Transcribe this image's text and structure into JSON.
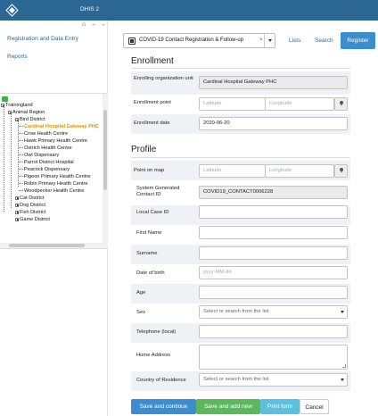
{
  "header": {
    "app_title": "DHIS 2",
    "logo_icon": "dhis2-logo-icon"
  },
  "sidebar": {
    "links": [
      "Registration and Data Entry",
      "Reports"
    ],
    "tree": {
      "root": "Trainingland",
      "region": "Animal Region",
      "district": "Bird District",
      "facilities": [
        "Cardinal Hospital Gateway PHC",
        "Crow Health Centre",
        "Hawk Primary Health Centre",
        "Ostrich Health Centre",
        "Owl Dispensary",
        "Parrot District Hospital",
        "Peacock Dispensary",
        "Pigeon Primary Health Centre",
        "Robin Primary Health Centre",
        "Woodpecker Health Centre"
      ],
      "other_districts": [
        "Cat District",
        "Dog District",
        "Fish District",
        "Game District"
      ]
    }
  },
  "program": {
    "selected": "COVID-19 Contact Registration & Follow-up",
    "clear": "×"
  },
  "top_nav": {
    "lists": "Lists",
    "search": "Search",
    "register": "Register"
  },
  "enrollment": {
    "title": "Enrollment",
    "org_unit_label": "Enrolling organization unit",
    "org_unit_value": "Cardinal Hospital Gateway PHC",
    "point_label": "Enrollment point",
    "latitude_ph": "Latitude",
    "longitude_ph": "Longitude",
    "date_label": "Enrollment date",
    "date_value": "2020-06-20"
  },
  "profile": {
    "title": "Profile",
    "point_label": "Point on map",
    "latitude_ph": "Latitude",
    "longitude_ph": "Longitude",
    "contact_id_label": "System Generated Contact ID",
    "contact_id_value": "COVID19_CONTACT0006228",
    "local_case_id_label": "Local Case ID",
    "first_name_label": "First Name",
    "surname_label": "Surname",
    "dob_label": "Date of birth",
    "dob_ph": "yyyy-MM-dd",
    "age_label": "Age",
    "sex_label": "Sex",
    "sex_ph": "Select or search from the list",
    "phone_label": "Telephone (local)",
    "address_label": "Home Address",
    "country_label": "Country of Residence",
    "country_ph": "Select or search from the list"
  },
  "actions": {
    "save_continue": "Save and continue",
    "save_add_new": "Save and add new",
    "print_form": "Print form",
    "cancel": "Cancel"
  },
  "colors": {
    "header": "#2c6693",
    "primary": "#3c8dcd",
    "success": "#5cb85c",
    "info": "#5bc0de",
    "selected_org_unit": "#e69000"
  }
}
